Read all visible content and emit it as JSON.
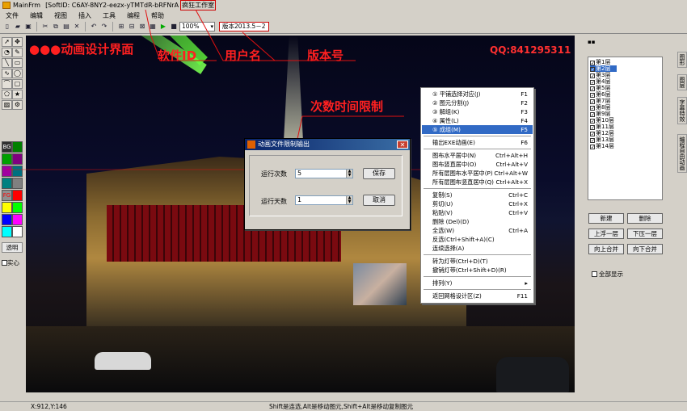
{
  "titlebar": {
    "app": "MainFrm",
    "softid": "[SoftID: C6AY-8NY2-eezx-yTMTdR-bRFNrA",
    "user": "疯狂工作室"
  },
  "menu": [
    "文件",
    "编辑",
    "视图",
    "插入",
    "工具",
    "编程",
    "帮助"
  ],
  "toolbar": {
    "zoom": "100%",
    "version": "版本2013.5－2"
  },
  "palette": {
    "bg_label": "BG",
    "fg_label": "FG",
    "transparent": "透明",
    "solid": "实心",
    "colors": [
      "#a00000",
      "#008000",
      "#00a000",
      "#800080",
      "#a000a0",
      "#007080",
      "#008080",
      "#808080",
      "#ff0000",
      "#ff0000",
      "#ffff00",
      "#00ff00",
      "#0000ff",
      "#ff00ff",
      "#00ffff",
      "#ffffff"
    ]
  },
  "annotations": {
    "main": "●●●动画设计界面",
    "softid": "软件ID",
    "user": "用户名",
    "version": "版本号",
    "limit": "次数时间限制",
    "qq": "QQ:841295311"
  },
  "dialog": {
    "title": "动画文件限制输出",
    "runs_label": "运行次数",
    "runs_value": "5",
    "days_label": "运行天数",
    "days_value": "1",
    "save": "保存",
    "cancel": "取消"
  },
  "context_menu": [
    {
      "label": "① 平铺选择对应(J)",
      "key": "F1"
    },
    {
      "label": "② 图元分割(J)",
      "key": "F2"
    },
    {
      "label": "③ 解组(K)",
      "key": "F3"
    },
    {
      "label": "④ 属性(L)",
      "key": "F4"
    },
    {
      "label": "⑤ 成组(M)",
      "key": "F5",
      "highlight": true
    },
    {
      "sep": true
    },
    {
      "label": "输出EXE动画(E)",
      "key": "F6"
    },
    {
      "sep": true
    },
    {
      "label": "图布水平居中(N)",
      "key": "Ctrl+Alt+H"
    },
    {
      "label": "图布竖直居中(O)",
      "key": "Ctrl+Alt+V"
    },
    {
      "label": "所有层图布水平居中(P)",
      "key": "Ctrl+Alt+W"
    },
    {
      "label": "所有层图布竖直居中(Q)",
      "key": "Ctrl+Alt+X"
    },
    {
      "sep": true
    },
    {
      "label": "复制(S)",
      "key": "Ctrl+C"
    },
    {
      "label": "剪切(U)",
      "key": "Ctrl+X"
    },
    {
      "label": "粘贴(V)",
      "key": "Ctrl+V"
    },
    {
      "label": "删除  (Del)(D)",
      "key": ""
    },
    {
      "label": "全选(W)",
      "key": "Ctrl+A"
    },
    {
      "label": "反选(Ctrl+Shift+A)(C)",
      "key": ""
    },
    {
      "label": "连续选择(A)",
      "key": ""
    },
    {
      "sep": true
    },
    {
      "label": "转为灯带(Ctrl+D)(T)",
      "key": ""
    },
    {
      "label": "撤销灯带(Ctrl+Shift+D)(R)",
      "key": ""
    },
    {
      "sep": true
    },
    {
      "label": "排列(Y)",
      "key": "▸"
    },
    {
      "sep": true
    },
    {
      "label": "返回网格设计区(Z)",
      "key": "F11"
    }
  ],
  "layers": [
    {
      "name": "第1层",
      "checked": true
    },
    {
      "name": "第2层",
      "checked": true,
      "selected": true
    },
    {
      "name": "第3层",
      "checked": true
    },
    {
      "name": "第4层",
      "checked": true
    },
    {
      "name": "第5层",
      "checked": true
    },
    {
      "name": "第6层",
      "checked": true
    },
    {
      "name": "第7层",
      "checked": true
    },
    {
      "name": "第8层",
      "checked": true
    },
    {
      "name": "第9层",
      "checked": true
    },
    {
      "name": "第10层",
      "checked": true
    },
    {
      "name": "第11层",
      "checked": true
    },
    {
      "name": "第12层",
      "checked": true
    },
    {
      "name": "第13层",
      "checked": true
    },
    {
      "name": "第14层",
      "checked": true
    }
  ],
  "layer_buttons": {
    "new": "新建",
    "delete": "删除",
    "up": "上浮一层",
    "down": "下压一层",
    "merge_up": "向上合并",
    "merge_down": "向下合并",
    "show_all": "全部显示"
  },
  "right_tabs": [
    "图形",
    "图层",
    "字幕特效",
    "编程自由动画"
  ],
  "status": {
    "coords": "X:912,Y:146",
    "hint": "Shift是连选,Alt是移动图元,Shift+Alt是移动复制图元"
  }
}
